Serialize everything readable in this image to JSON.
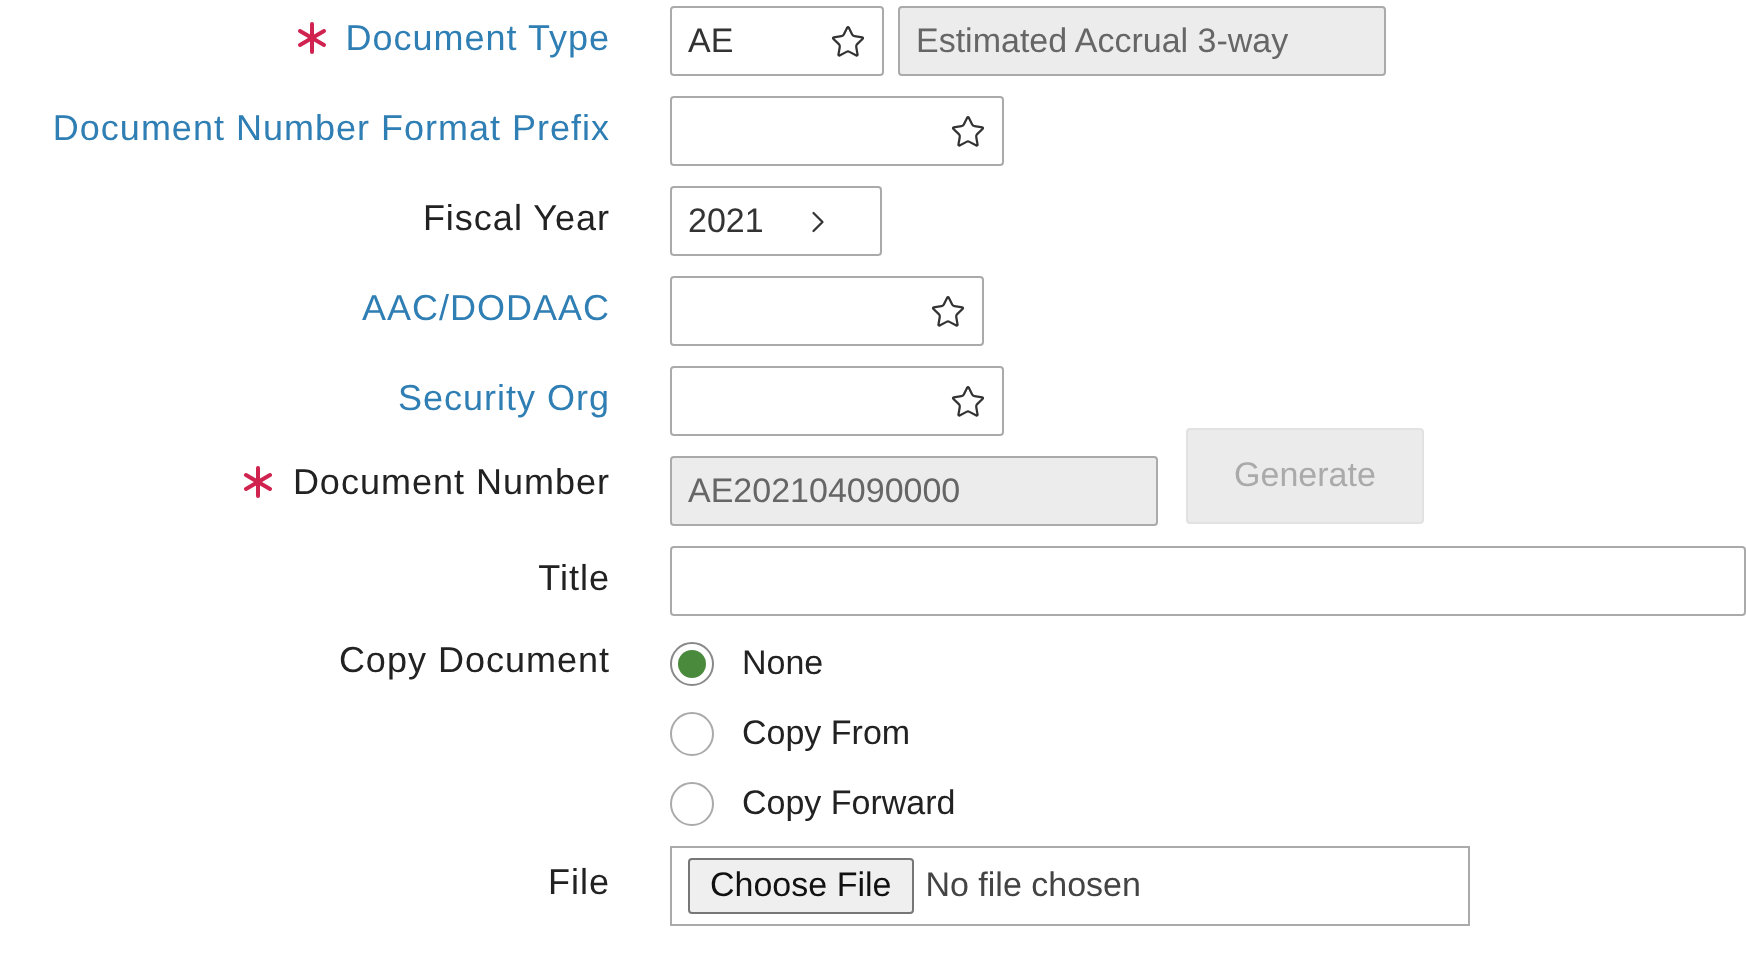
{
  "fields": [
    {
      "kind": "lookup",
      "label": "Document Type",
      "required": true,
      "linked": true,
      "value": "AE",
      "description": "Estimated Accrual 3-way"
    },
    {
      "kind": "lookup",
      "label": "Document Number Format Prefix",
      "required": false,
      "linked": true
    },
    {
      "kind": "year",
      "label": "Fiscal Year",
      "required": false,
      "linked": false,
      "value": "2021"
    },
    {
      "kind": "lookup",
      "label": "AAC/DODAAC",
      "required": false,
      "linked": true
    },
    {
      "kind": "lookup",
      "label": "Security Org",
      "required": false,
      "linked": true
    },
    {
      "kind": "generated",
      "label": "Document Number",
      "required": true,
      "linked": false,
      "value": "AE202104090000",
      "button": {
        "label": "Generate",
        "disabled": true
      }
    },
    {
      "kind": "text",
      "label": "Title",
      "required": false,
      "linked": false
    },
    {
      "kind": "radio",
      "label": "Copy Document",
      "required": false,
      "linked": false,
      "options": [
        {
          "label": "None",
          "selected": true
        },
        {
          "label": "Copy From",
          "selected": false
        },
        {
          "label": "Copy Forward",
          "selected": false
        }
      ]
    },
    {
      "kind": "file",
      "label": "File",
      "required": false,
      "linked": false,
      "button": "Choose File",
      "status": "No file chosen"
    }
  ]
}
